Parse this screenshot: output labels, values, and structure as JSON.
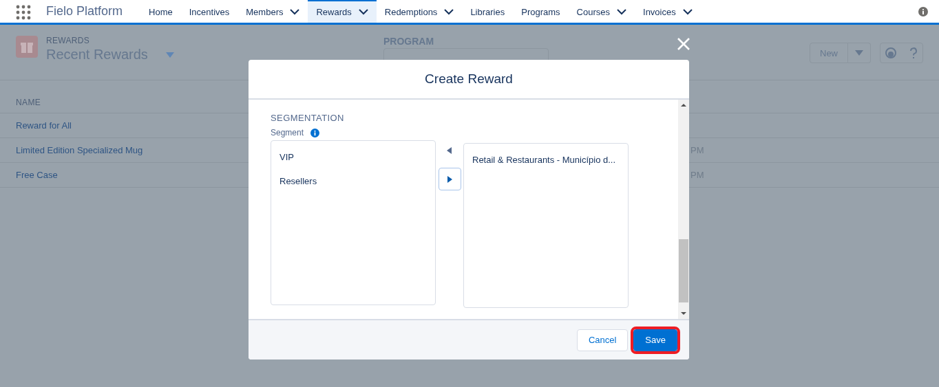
{
  "app": {
    "name": "Fielo Platform"
  },
  "nav": [
    {
      "label": "Home",
      "has_menu": false,
      "selected": false
    },
    {
      "label": "Incentives",
      "has_menu": false,
      "selected": false
    },
    {
      "label": "Members",
      "has_menu": true,
      "selected": false
    },
    {
      "label": "Rewards",
      "has_menu": true,
      "selected": true
    },
    {
      "label": "Redemptions",
      "has_menu": true,
      "selected": false
    },
    {
      "label": "Libraries",
      "has_menu": false,
      "selected": false
    },
    {
      "label": "Programs",
      "has_menu": false,
      "selected": false
    },
    {
      "label": "Courses",
      "has_menu": true,
      "selected": false
    },
    {
      "label": "Invoices",
      "has_menu": true,
      "selected": false
    }
  ],
  "page": {
    "object_label": "REWARDS",
    "list_view": "Recent Rewards",
    "program_label": "PROGRAM",
    "new_button": "New",
    "table": {
      "columns": [
        "NAME"
      ],
      "rows": [
        {
          "name": "Reward for All"
        },
        {
          "name": "Limited Edition Specialized Mug",
          "column_2": "PM"
        },
        {
          "name": "Free Case",
          "column_2": "PM"
        }
      ]
    }
  },
  "modal": {
    "title": "Create Reward",
    "section": "SEGMENTATION",
    "field_label": "Segment",
    "available": [
      {
        "label": "VIP"
      },
      {
        "label": "Resellers"
      }
    ],
    "chosen": [
      {
        "label": "Retail & Restaurants - Município d..."
      }
    ],
    "buttons": [
      {
        "label": "Cancel",
        "kind": "neutral",
        "highlighted": false
      },
      {
        "label": "Save",
        "kind": "brand",
        "highlighted": true
      }
    ]
  }
}
